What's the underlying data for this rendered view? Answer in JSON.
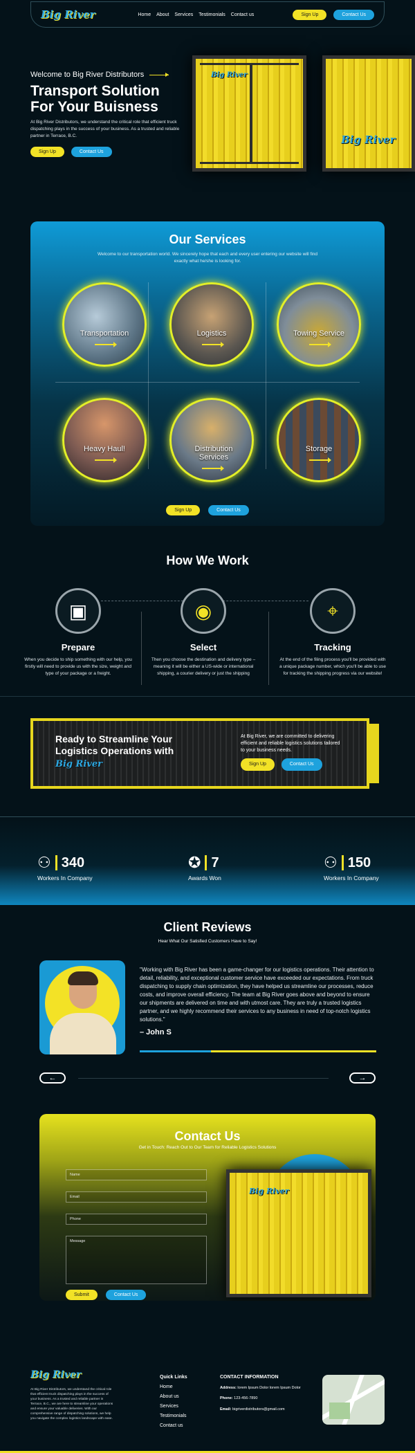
{
  "brand": {
    "logo": "Big River"
  },
  "nav": {
    "links": [
      "Home",
      "About",
      "Services",
      "Testimonials",
      "Contact us"
    ],
    "signup": "Sign Up",
    "contact": "Contact Us"
  },
  "hero": {
    "welcome": "Welcome to Big River Distributors",
    "title_line1": "Transport Solution",
    "title_line2": "For Your Buisness",
    "description": "At Big River Distributors, we understand the critical role that efficient truck dispatching plays in the success of your business. As a trusted and reliable partner in Terrace, B.C.",
    "signup": "Sign Up",
    "contact": "Contact Us"
  },
  "services": {
    "title": "Our Services",
    "subtitle": "Welcome to our transportation world. We sincerely hope that each and every user entering our website will find exactly what he/she is looking for.",
    "items": [
      "Transportation",
      "Logistics",
      "Towing Service",
      "Heavy Haul!",
      "Distribution Services",
      "Storage"
    ],
    "signup": "Sign Up",
    "contact": "Contact Us"
  },
  "how": {
    "title": "How We Work",
    "steps": [
      {
        "title": "Prepare",
        "text": "When you decide to ship something with our help, you firstly will need to provide us with the size, weight and type of your package or a freight."
      },
      {
        "title": "Select",
        "text": "Then you choose the destination and delivery type – meaning it will be either a US-wide or international shipping, a courier delivery or just the shipping"
      },
      {
        "title": "Tracking",
        "text": "At the end of the filing process you'll be provided with a unique package number, which you'll be able to use for tracking the shipping progress via our website!"
      }
    ]
  },
  "banner": {
    "title": "Ready to Streamline Your Logistics Operations with",
    "description": "At Big River, we are committed to delivering efficient and reliable logistics solutions tailored to your business needs.",
    "signup": "Sign Up",
    "contact": "Contact Us"
  },
  "stats": [
    {
      "value": "340",
      "label": "Workers In Company",
      "icon": "workers-icon"
    },
    {
      "value": "7",
      "label": "Awards Won",
      "icon": "award-icon"
    },
    {
      "value": "150",
      "label": "Workers In Company",
      "icon": "team-icon"
    }
  ],
  "reviews": {
    "title": "Client Reviews",
    "subtitle": "Hear What Our Satisfied Customers Have to Say!",
    "quote": "\"Working with Big River has been a game-changer for our logistics operations. Their attention to detail, reliability, and exceptional customer service have exceeded our expectations. From truck dispatching to supply chain optimization, they have helped us streamline our processes, reduce costs, and improve overall efficiency. The team at Big River goes above and beyond to ensure our shipments are delivered on time and with utmost care. They are truly a trusted logistics partner, and we highly recommend their services to any business in need of top-notch logistics solutions.\"",
    "author": "– John S"
  },
  "contact": {
    "title": "Contact Us",
    "subtitle": "Get in Touch: Reach Out to Our Team for Reliable Logistics Solutions",
    "name_ph": "Name",
    "email_ph": "Email",
    "phone_ph": "Phone",
    "message_ph": "Message",
    "submit": "Submit",
    "contact": "Contact Us"
  },
  "footer": {
    "description": "At Big River Distributors, we understand the critical role that efficient truck dispatching plays in the success of your business. As a trusted and reliable partner in Terrace, B.C., we are here to streamline your operations and ensure your valuable deliveries. With our comprehensive range of dispatching solutions, we help you navigate the complex logistics landscape with ease.",
    "quick_title": "Quick Links",
    "links": [
      "Home",
      "About us",
      "Services",
      "Testimonials",
      "Contact us"
    ],
    "info_title": "CONTACT INFORMATION",
    "address_label": "Address:",
    "address": "lorem Ipsum Dolor lorem Ipsum Dolor",
    "phone_label": "Phone:",
    "phone": "123-456-7890",
    "email_label": "Email:",
    "email": "bigriverdistributors@gmail.com"
  }
}
